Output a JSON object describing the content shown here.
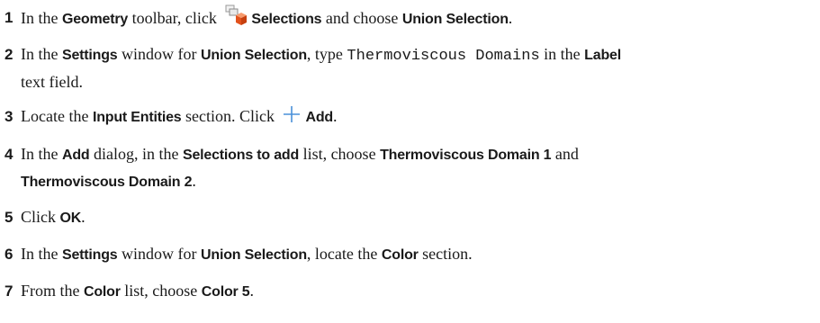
{
  "steps": [
    {
      "n": "1",
      "parts": [
        {
          "t": "In the "
        },
        {
          "t": "Geometry",
          "b": true
        },
        {
          "t": " toolbar, click "
        },
        {
          "icon": "selections-icon"
        },
        {
          "t": "Selections",
          "b": true
        },
        {
          "t": " and choose "
        },
        {
          "t": "Union Selection",
          "b": true
        },
        {
          "t": "."
        }
      ]
    },
    {
      "n": "2",
      "parts": [
        {
          "t": "In the "
        },
        {
          "t": "Settings",
          "b": true
        },
        {
          "t": " window for "
        },
        {
          "t": "Union Selection",
          "b": true
        },
        {
          "t": ", type "
        },
        {
          "t": "Thermoviscous Domains",
          "m": true
        },
        {
          "t": " in the "
        },
        {
          "t": "Label",
          "b": true
        },
        {
          "br": true
        },
        {
          "t": "text field."
        }
      ]
    },
    {
      "n": "3",
      "parts": [
        {
          "t": "Locate the "
        },
        {
          "t": "Input Entities",
          "b": true
        },
        {
          "t": " section. Click "
        },
        {
          "icon": "add-icon"
        },
        {
          "t": "Add",
          "b": true
        },
        {
          "t": "."
        }
      ]
    },
    {
      "n": "4",
      "parts": [
        {
          "t": "In the "
        },
        {
          "t": "Add",
          "b": true
        },
        {
          "t": " dialog, in the "
        },
        {
          "t": "Selections to add",
          "b": true
        },
        {
          "t": " list, choose "
        },
        {
          "t": "Thermoviscous Domain 1",
          "b": true
        },
        {
          "t": " and"
        },
        {
          "br": true
        },
        {
          "t": "Thermoviscous Domain 2",
          "b": true
        },
        {
          "t": "."
        }
      ]
    },
    {
      "n": "5",
      "parts": [
        {
          "t": "Click "
        },
        {
          "t": "OK",
          "b": true
        },
        {
          "t": "."
        }
      ]
    },
    {
      "n": "6",
      "parts": [
        {
          "t": "In the "
        },
        {
          "t": "Settings",
          "b": true
        },
        {
          "t": " window for "
        },
        {
          "t": "Union Selection",
          "b": true
        },
        {
          "t": ", locate the "
        },
        {
          "t": "Color",
          "b": true
        },
        {
          "t": " section."
        }
      ]
    },
    {
      "n": "7",
      "parts": [
        {
          "t": "From the "
        },
        {
          "t": "Color",
          "b": true
        },
        {
          "t": " list, choose "
        },
        {
          "t": "Color 5",
          "b": true
        },
        {
          "t": "."
        }
      ]
    }
  ]
}
